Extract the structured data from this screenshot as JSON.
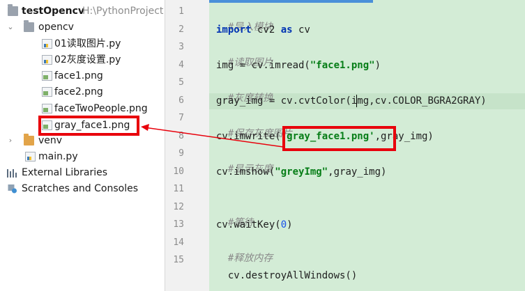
{
  "project": {
    "name": "testOpencv",
    "path": "H:\\PythonProject",
    "folders": {
      "opencv": "opencv",
      "venv": "venv"
    },
    "files": {
      "f1": "01读取图片.py",
      "f2": "02灰度设置.py",
      "f3": "face1.png",
      "f4": "face2.png",
      "f5": "faceTwoPeople.png",
      "f6": "gray_face1.png",
      "main": "main.py"
    },
    "external_libraries": "External Libraries",
    "scratches": "Scratches and Consoles"
  },
  "editor": {
    "line_numbers": [
      "1",
      "2",
      "3",
      "4",
      "5",
      "6",
      "7",
      "8",
      "9",
      "10",
      "11",
      "12",
      "13",
      "14",
      "15"
    ],
    "lines": {
      "l1": "#导入模块",
      "l2_kw1": "import",
      "l2_mid": " cv2 ",
      "l2_kw2": "as",
      "l2_end": " cv",
      "l3": "#读取图片",
      "l4_a": "img = cv.imread(",
      "l4_s": "\"face1.png\"",
      "l4_b": ")",
      "l5": "#灰度转换",
      "l6_a": "gray_img = cv.cvtColor(i",
      "l6_b": "mg,cv.COLOR_BGRA2GRAY)",
      "l7": "#保存灰度图片",
      "l8_a": "cv.imwrite(",
      "l8_s": "'gray_face1.png'",
      "l8_b": ",gray_img)",
      "l9": "#显示灰度",
      "l10_a": "cv.imshow(",
      "l10_s": "\"greyImg\"",
      "l10_b": ",gray_img)",
      "l12": "#等待",
      "l13_a": "cv.waitKey(",
      "l13_n": "0",
      "l13_b": ")",
      "l14": "#释放内存",
      "l15": "cv.destroyAllWindows()"
    }
  },
  "colors": {
    "annotation": "#e8000b",
    "editor_bg": "#d3ecd6",
    "keyword": "#0033b3",
    "string": "#067d17"
  }
}
